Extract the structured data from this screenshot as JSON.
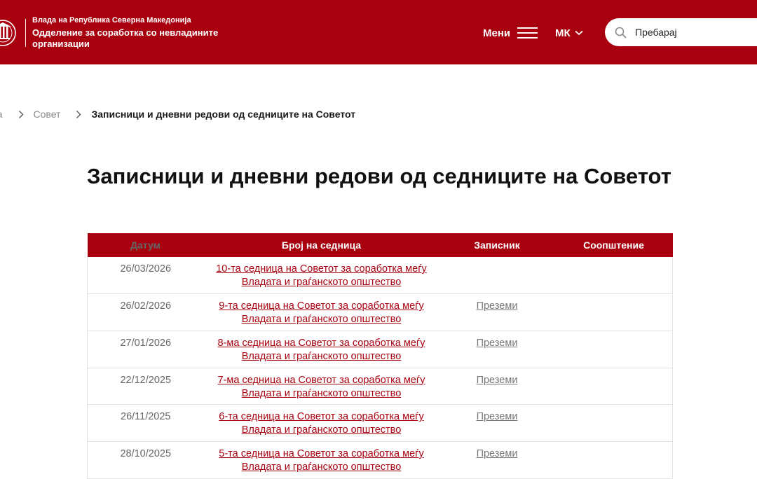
{
  "header": {
    "org_sup": "Влада на Република Северна Македонија",
    "org_name": "Одделение за соработка со невладините организации",
    "menu_label": "Мени",
    "lang_label": "МК",
    "search_placeholder": "Пребарај",
    "brand_color": "#a8000f"
  },
  "breadcrumb": {
    "home": "на",
    "council": "Совет",
    "current": "Записници и дневни редови од седниците на Советот"
  },
  "page_title": "Записници и дневни редови од седниците на Советот",
  "table": {
    "headers": {
      "date": "Датум",
      "session": "Број на седница",
      "minutes": "Записник",
      "notice": "Соопштение"
    },
    "rows": [
      {
        "date": "26/03/2026",
        "session_line1": "10-та седница на Советот за соработка меѓу",
        "session_line2": "Владата и граѓанското општество",
        "minutes": "",
        "notice": ""
      },
      {
        "date": "26/02/2026",
        "session_line1": "9-та седница на Советот за соработка меѓу",
        "session_line2": "Владата и граѓанското општество",
        "minutes": "Преземи",
        "notice": ""
      },
      {
        "date": "27/01/2026",
        "session_line1": "8-ма седница на Советот за соработка меѓу",
        "session_line2": "Владата и граѓанското општество",
        "minutes": "Преземи",
        "notice": ""
      },
      {
        "date": "22/12/2025",
        "session_line1": "7-ма седница на Советот за соработка меѓу",
        "session_line2": "Владата и граѓанското општество",
        "minutes": "Преземи",
        "notice": ""
      },
      {
        "date": "26/11/2025",
        "session_line1": "6-та седница на Советот за соработка меѓу",
        "session_line2": "Владата и граѓанското општество",
        "minutes": "Преземи",
        "notice": ""
      },
      {
        "date": "28/10/2025",
        "session_line1": "5-та седница на Советот за соработка меѓу",
        "session_line2": "Владата и граѓанското општество",
        "minutes": "Преземи",
        "notice": ""
      }
    ]
  }
}
